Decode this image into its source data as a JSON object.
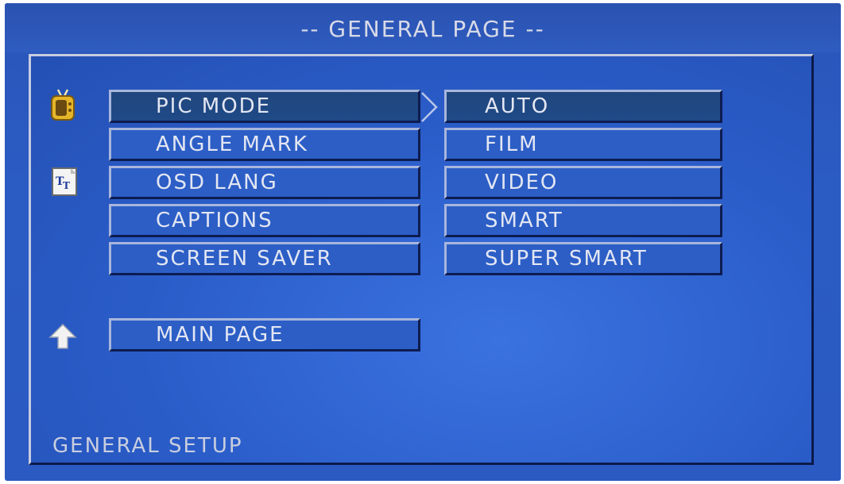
{
  "header": {
    "title": "-- GENERAL PAGE --"
  },
  "menu": {
    "items": [
      {
        "label": "PIC MODE",
        "selected": true
      },
      {
        "label": "ANGLE MARK",
        "selected": false
      },
      {
        "label": "OSD LANG",
        "selected": false
      },
      {
        "label": "CAPTIONS",
        "selected": false
      },
      {
        "label": "SCREEN SAVER",
        "selected": false
      }
    ],
    "main_page_label": "MAIN PAGE"
  },
  "options": {
    "items": [
      {
        "label": "AUTO",
        "selected": true
      },
      {
        "label": "FILM",
        "selected": false
      },
      {
        "label": "VIDEO",
        "selected": false
      },
      {
        "label": "SMART",
        "selected": false
      },
      {
        "label": "SUPER SMART",
        "selected": false
      }
    ]
  },
  "footer": {
    "label": "GENERAL SETUP"
  },
  "icons": {
    "tv": "tv-icon",
    "text": "text-settings-icon",
    "up": "up-arrow-icon",
    "pointer": "chevron-right-icon"
  },
  "colors": {
    "background": "#2a5ac2",
    "selected": "#1f4a86",
    "text": "#e3e6f2"
  }
}
